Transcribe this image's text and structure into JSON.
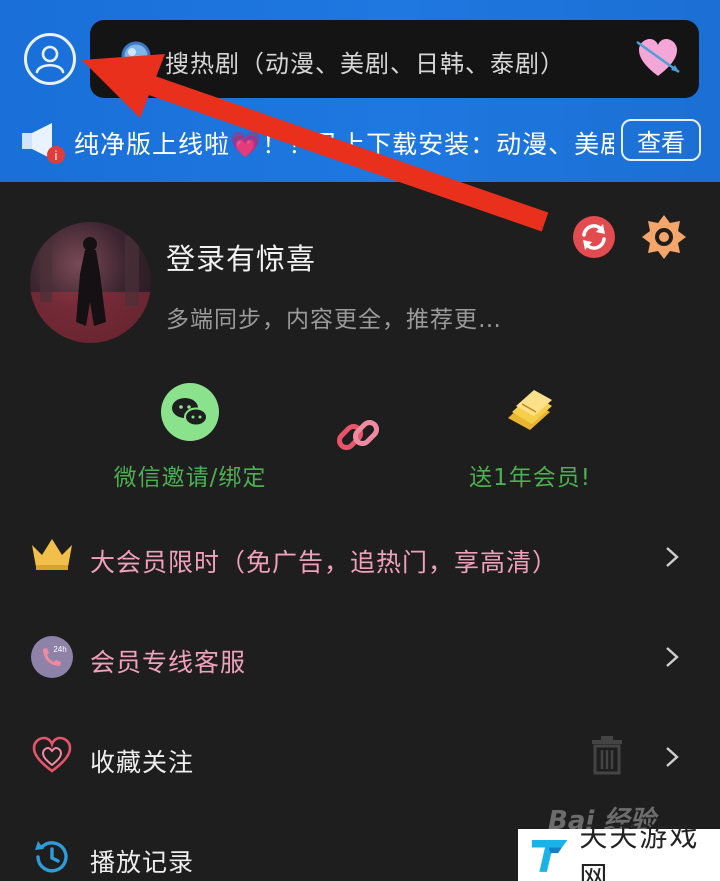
{
  "header": {
    "search_placeholder": "搜热剧（动漫、美剧、日韩、泰剧）",
    "notice_text": "纯净版上线啦💗！！马上下载安装：动漫、美剧",
    "notice_button": "查看"
  },
  "profile": {
    "title": "登录有惊喜",
    "subtitle": "多端同步，内容更全，推荐更…"
  },
  "actions": {
    "wechat_label": "微信邀请/绑定",
    "gift_label": "送1年会员!"
  },
  "menu": {
    "items": [
      {
        "label": "大会员限时（免广告，追热门，享高清）",
        "color": "#f0a0bb",
        "icon": "crown-icon"
      },
      {
        "label": "会员专线客服",
        "color": "#f0a0bb",
        "icon": "phone-icon"
      },
      {
        "label": "收藏关注",
        "color": "#eeeeee",
        "icon": "heart-outline-icon"
      },
      {
        "label": "播放记录",
        "color": "#eeeeee",
        "icon": "history-icon"
      }
    ]
  },
  "watermark": {
    "baidu": "Bai 经验",
    "site": "天天游戏网"
  },
  "colors": {
    "header_blue": "#1e78e0",
    "background": "#1e1e1e",
    "accent_green": "#4caf50",
    "pink": "#f0a0bb",
    "annotation_red": "#e8301c"
  }
}
